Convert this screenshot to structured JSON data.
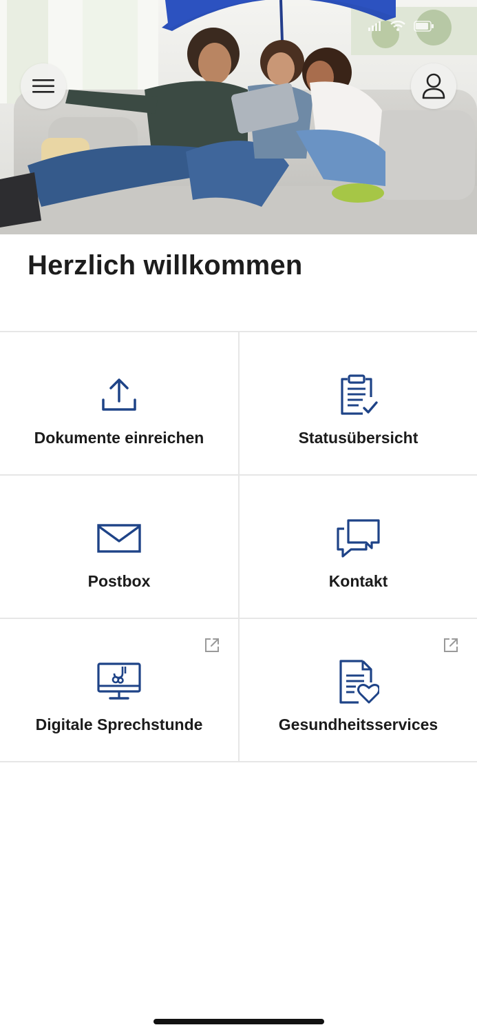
{
  "header": {
    "menu_icon": "hamburger-menu-icon",
    "profile_icon": "person-icon",
    "status_icons": [
      "signal-icon",
      "wifi-icon",
      "battery-icon"
    ]
  },
  "welcome_title": "Herzlich willkommen",
  "tiles": [
    {
      "label": "Dokumente einreichen",
      "icon": "upload-icon",
      "external": false
    },
    {
      "label": "Statusübersicht",
      "icon": "clipboard-check-icon",
      "external": false
    },
    {
      "label": "Postbox",
      "icon": "envelope-icon",
      "external": false
    },
    {
      "label": "Kontakt",
      "icon": "chat-bubbles-icon",
      "external": false
    },
    {
      "label": "Digitale Sprechstunde",
      "icon": "monitor-stethoscope-icon",
      "external": true
    },
    {
      "label": "Gesundheitsservices",
      "icon": "document-heart-icon",
      "external": true
    }
  ],
  "colors": {
    "accent": "#1e4387",
    "divider": "#e6e6e6",
    "text": "#1b1b1b",
    "umbrella": "#2a4fb8"
  }
}
